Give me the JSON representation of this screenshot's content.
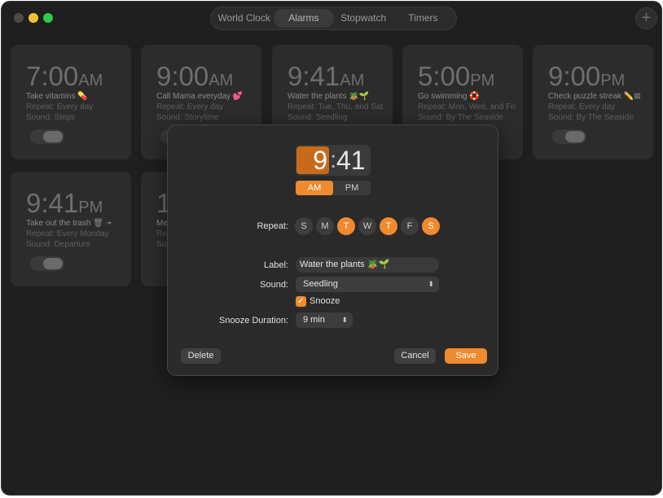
{
  "window": {
    "tabs": [
      {
        "label": "World Clock"
      },
      {
        "label": "Alarms"
      },
      {
        "label": "Stopwatch"
      },
      {
        "label": "Timers"
      }
    ],
    "add_label": "+"
  },
  "alarms": [
    {
      "time": "7:00",
      "ampm": "AM",
      "label": "Take vitamins 💊",
      "repeat": "Repeat: Every day",
      "sound": "Sound: Steps",
      "enabled": false
    },
    {
      "time": "9:00",
      "ampm": "AM",
      "label": "Call Mama everyday 💕",
      "repeat": "Repeat: Every day",
      "sound": "Sound: Storytime",
      "enabled": false
    },
    {
      "time": "9:41",
      "ampm": "AM",
      "label": "Water the plants 🪴🌱",
      "repeat": "Repeat: Tue, Thu, and Sat",
      "sound": "Sound: Seedling",
      "enabled": false
    },
    {
      "time": "5:00",
      "ampm": "PM",
      "label": "Go swimming 🛟",
      "repeat": "Repeat: Mon, Wed, and Fri",
      "sound": "Sound: By The Seaside",
      "enabled": false
    },
    {
      "time": "9:00",
      "ampm": "PM",
      "label": "Check puzzle streak ✏️⊠",
      "repeat": "Repeat: Every day",
      "sound": "Sound: By The Seaside",
      "enabled": false
    },
    {
      "time": "9:41",
      "ampm": "PM",
      "label": "Take out the trash 🗑 ➛",
      "repeat": "Repeat: Every Monday",
      "sound": "Sound: Departure",
      "enabled": false
    },
    {
      "time": "1",
      "ampm": "",
      "label": "Me",
      "repeat": "Re",
      "sound": "So",
      "enabled": false
    }
  ],
  "editor": {
    "hour": "9",
    "minutes": "41",
    "am_label": "AM",
    "pm_label": "PM",
    "selected_period": "AM",
    "repeat_label": "Repeat:",
    "days": [
      {
        "letter": "S",
        "on": false
      },
      {
        "letter": "M",
        "on": false
      },
      {
        "letter": "T",
        "on": true
      },
      {
        "letter": "W",
        "on": false
      },
      {
        "letter": "T",
        "on": true
      },
      {
        "letter": "F",
        "on": false
      },
      {
        "letter": "S",
        "on": true
      }
    ],
    "label_label": "Label:",
    "label_value": "Water the plants 🪴🌱",
    "sound_label": "Sound:",
    "sound_value": "Seedling",
    "snooze_label": "Snooze",
    "snooze_checked": true,
    "snooze_duration_label": "Snooze Duration:",
    "snooze_duration_value": "9 min",
    "delete_label": "Delete",
    "cancel_label": "Cancel",
    "save_label": "Save"
  },
  "colors": {
    "accent": "#f08a2e",
    "hour_highlight": "#c96a1a"
  },
  "icons": {
    "select_chevron": "chevron-up-down-icon",
    "checkmark": "checkmark-icon",
    "add": "plus-icon"
  }
}
